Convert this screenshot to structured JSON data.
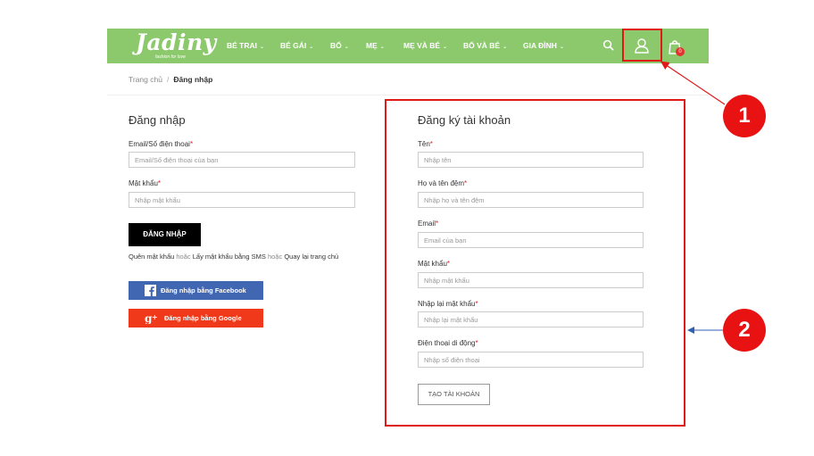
{
  "header": {
    "logo_text": "Jadiny",
    "logo_tagline": "fashion for love",
    "nav": [
      {
        "label": "BÉ TRAI"
      },
      {
        "label": "BÉ GÁI"
      },
      {
        "label": "BỐ"
      },
      {
        "label": "MẸ"
      },
      {
        "label": "MẸ VÀ BÉ"
      },
      {
        "label": "BỐ VÀ BÉ"
      },
      {
        "label": "GIA ĐÌNH"
      }
    ],
    "cart_count": "0",
    "icons": [
      "search-icon",
      "user-icon",
      "cart-icon"
    ]
  },
  "breadcrumb": {
    "home": "Trang chủ",
    "separator": "/",
    "current": "Đăng nhập"
  },
  "login": {
    "title": "Đăng nhập",
    "email_label": "Email/Số điện thoại",
    "email_placeholder": "Email/Số điện thoại của bạn",
    "password_label": "Mật khẩu",
    "password_placeholder": "Nhập mật khẩu",
    "required_mark": "*",
    "submit_label": "ĐĂNG NHẬP",
    "forgot_link": "Quên mật khẩu",
    "or_1": "hoặc",
    "sms_link": "Lấy mật khẩu bằng SMS",
    "or_2": "hoặc",
    "home_link": "Quay lại trang chủ",
    "facebook_label": "Đăng nhập bằng Facebook",
    "google_label": "Đăng nhập bằng Google"
  },
  "register": {
    "title": "Đăng ký tài khoản",
    "required_mark": "*",
    "fields": [
      {
        "label": "Tên",
        "placeholder": "Nhập tên"
      },
      {
        "label": "Họ và tên đệm",
        "placeholder": "Nhập họ và tên đệm"
      },
      {
        "label": "Email",
        "placeholder": "Email của bạn"
      },
      {
        "label": "Mật khẩu",
        "placeholder": "Nhập mật khẩu"
      },
      {
        "label": "Nhập lại mật khẩu",
        "placeholder": "Nhập lại mật khẩu"
      },
      {
        "label": "Điện thoại di động",
        "placeholder": "Nhập số điện thoại"
      }
    ],
    "submit_label": "TẠO TÀI KHOẢN"
  },
  "annotations": {
    "callout_1": "1",
    "callout_2": "2"
  },
  "colors": {
    "nav_bg": "#8cc96c",
    "highlight": "#e01818",
    "callout": "#e81212",
    "facebook": "#4267b2",
    "google": "#f0391a"
  }
}
